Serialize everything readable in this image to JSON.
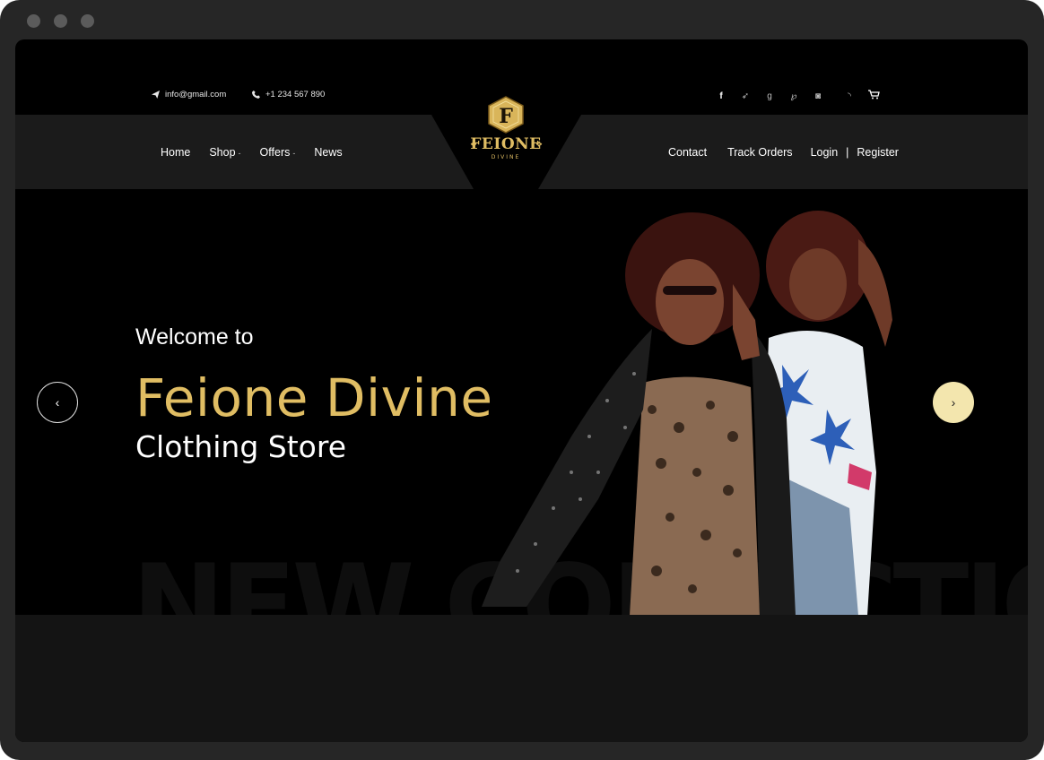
{
  "topbar": {
    "email": "info@gmail.com",
    "phone": "+1 234 567 890",
    "social_icons": [
      "facebook-icon",
      "twitter-icon",
      "google-plus-icon",
      "pinterest-icon",
      "instagram-icon",
      "rss-icon",
      "cart-icon"
    ]
  },
  "logo": {
    "letter": "F",
    "name": "FEIONE",
    "sub": "DIVINE"
  },
  "nav_left": [
    {
      "label": "Home",
      "dropdown": false
    },
    {
      "label": "Shop",
      "dropdown": true
    },
    {
      "label": "Offers",
      "dropdown": true
    },
    {
      "label": "News",
      "dropdown": false
    }
  ],
  "nav_right": {
    "contact": "Contact",
    "track": "Track Orders",
    "login": "Login",
    "separator": "|",
    "register": "Register"
  },
  "hero": {
    "welcome": "Welcome to",
    "brand": "Feione Divine",
    "subtitle": "Clothing Store",
    "watermark": "NEW COLLECTION",
    "prev_arrow": "‹",
    "next_arrow": "›"
  },
  "colors": {
    "accent": "#e0bd63",
    "next_button": "#f3e6ae",
    "background": "#000000",
    "nav_band": "#1b1b1b"
  }
}
